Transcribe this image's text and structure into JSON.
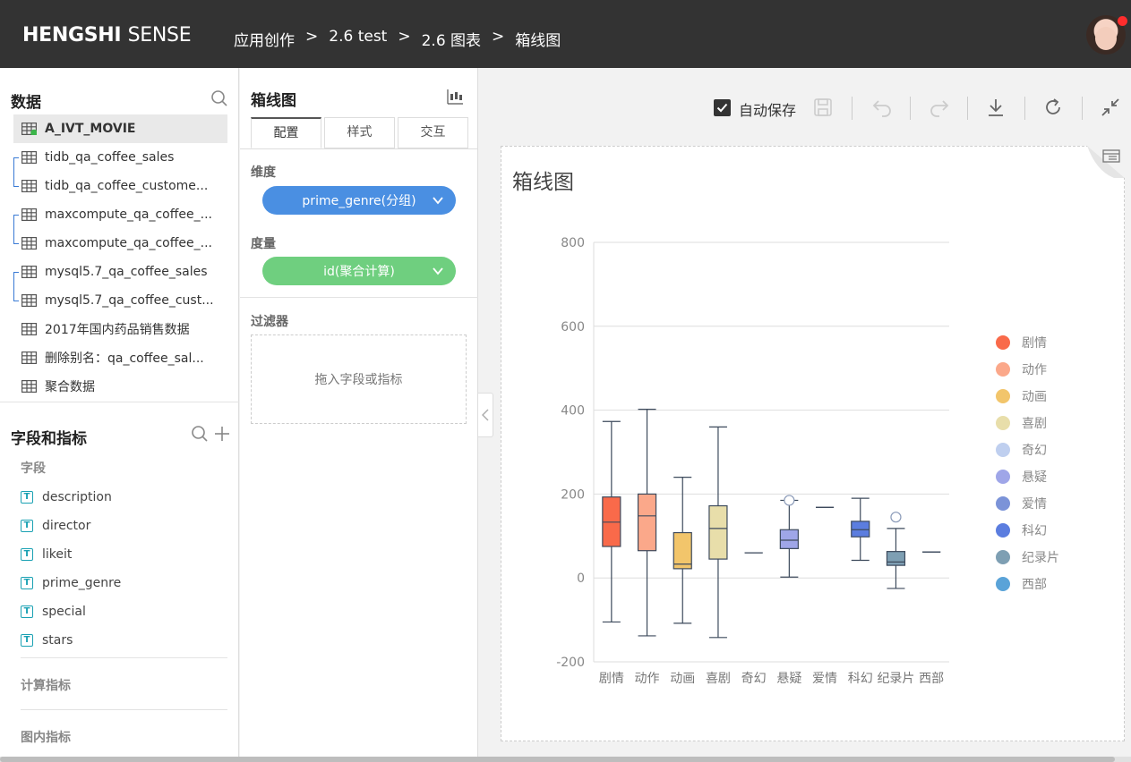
{
  "header": {
    "brand_bold": "HENGSHI",
    "brand_light": "SENSE",
    "breadcrumbs": [
      "应用创作",
      "2.6 test",
      "2.6 图表",
      "箱线图"
    ],
    "separator": ">"
  },
  "data_panel": {
    "title": "数据",
    "datasets": [
      {
        "label": "A_IVT_MOVIE",
        "active": true
      },
      {
        "label": "tidb_qa_coffee_sales"
      },
      {
        "label": "tidb_qa_coffee_custome..."
      },
      {
        "label": "maxcompute_qa_coffee_..."
      },
      {
        "label": "maxcompute_qa_coffee_..."
      },
      {
        "label": "mysql5.7_qa_coffee_sales"
      },
      {
        "label": "mysql5.7_qa_coffee_cust..."
      },
      {
        "label": "2017年国内药品销售数据"
      },
      {
        "label": "删除别名：qa_coffee_sal..."
      },
      {
        "label": "聚合数据"
      }
    ]
  },
  "fields_panel": {
    "title": "字段和指标",
    "fields_label": "字段",
    "fields": [
      "description",
      "director",
      "likeit",
      "prime_genre",
      "special",
      "stars"
    ],
    "field_type_glyph": "T",
    "calc_label": "计算指标",
    "chart_metric_label": "图内指标"
  },
  "config_panel": {
    "title": "箱线图",
    "tabs": [
      "配置",
      "样式",
      "交互"
    ],
    "dimension_label": "维度",
    "dimension_value": "prime_genre(分组)",
    "dimension_color": "#4a8fe2",
    "measure_label": "度量",
    "measure_value": "id(聚合计算)",
    "measure_color": "#6fcf7f",
    "filter_label": "过滤器",
    "filter_placeholder": "拖入字段或指标"
  },
  "toolbar": {
    "autosave_label": "自动保存",
    "autosave_checked": true
  },
  "chart_card": {
    "title": "箱线图"
  },
  "chart_data": {
    "type": "boxplot",
    "ylim": [
      -200,
      800
    ],
    "yticks": [
      -200,
      0,
      200,
      400,
      600,
      800
    ],
    "categories": [
      "剧情",
      "动作",
      "动画",
      "喜剧",
      "奇幻",
      "悬疑",
      "爱情",
      "科幻",
      "纪录片",
      "西部"
    ],
    "colors": [
      "#f96a4a",
      "#fba88a",
      "#f2c56b",
      "#e8deaa",
      "#bfcfef",
      "#9fa6e8",
      "#7b93d8",
      "#5b7ddf",
      "#7e9fb3",
      "#5aa3d8"
    ],
    "boxes": [
      {
        "min": -105,
        "q1": 75,
        "median": 133,
        "q3": 193,
        "max": 373
      },
      {
        "min": -138,
        "q1": 65,
        "median": 148,
        "q3": 200,
        "max": 402
      },
      {
        "min": -108,
        "q1": 22,
        "median": 33,
        "q3": 108,
        "max": 240
      },
      {
        "min": -142,
        "q1": 45,
        "median": 118,
        "q3": 172,
        "max": 360
      },
      {
        "min": 60,
        "q1": 60,
        "median": 60,
        "q3": 60,
        "max": 60
      },
      {
        "min": 2,
        "q1": 70,
        "median": 90,
        "q3": 115,
        "max": 185
      },
      {
        "min": 168,
        "q1": 168,
        "median": 168,
        "q3": 168,
        "max": 168
      },
      {
        "min": 42,
        "q1": 98,
        "median": 115,
        "q3": 135,
        "max": 190
      },
      {
        "min": -25,
        "q1": 30,
        "median": 38,
        "q3": 63,
        "max": 118
      },
      {
        "min": 62,
        "q1": 62,
        "median": 62,
        "q3": 62,
        "max": 62
      }
    ],
    "outliers": [
      {
        "category": "悬疑",
        "value": 185
      },
      {
        "category": "纪录片",
        "value": 145
      }
    ],
    "legend": [
      "剧情",
      "动作",
      "动画",
      "喜剧",
      "奇幻",
      "悬疑",
      "爱情",
      "科幻",
      "纪录片",
      "西部"
    ],
    "legend_position": "right",
    "grid": true
  }
}
